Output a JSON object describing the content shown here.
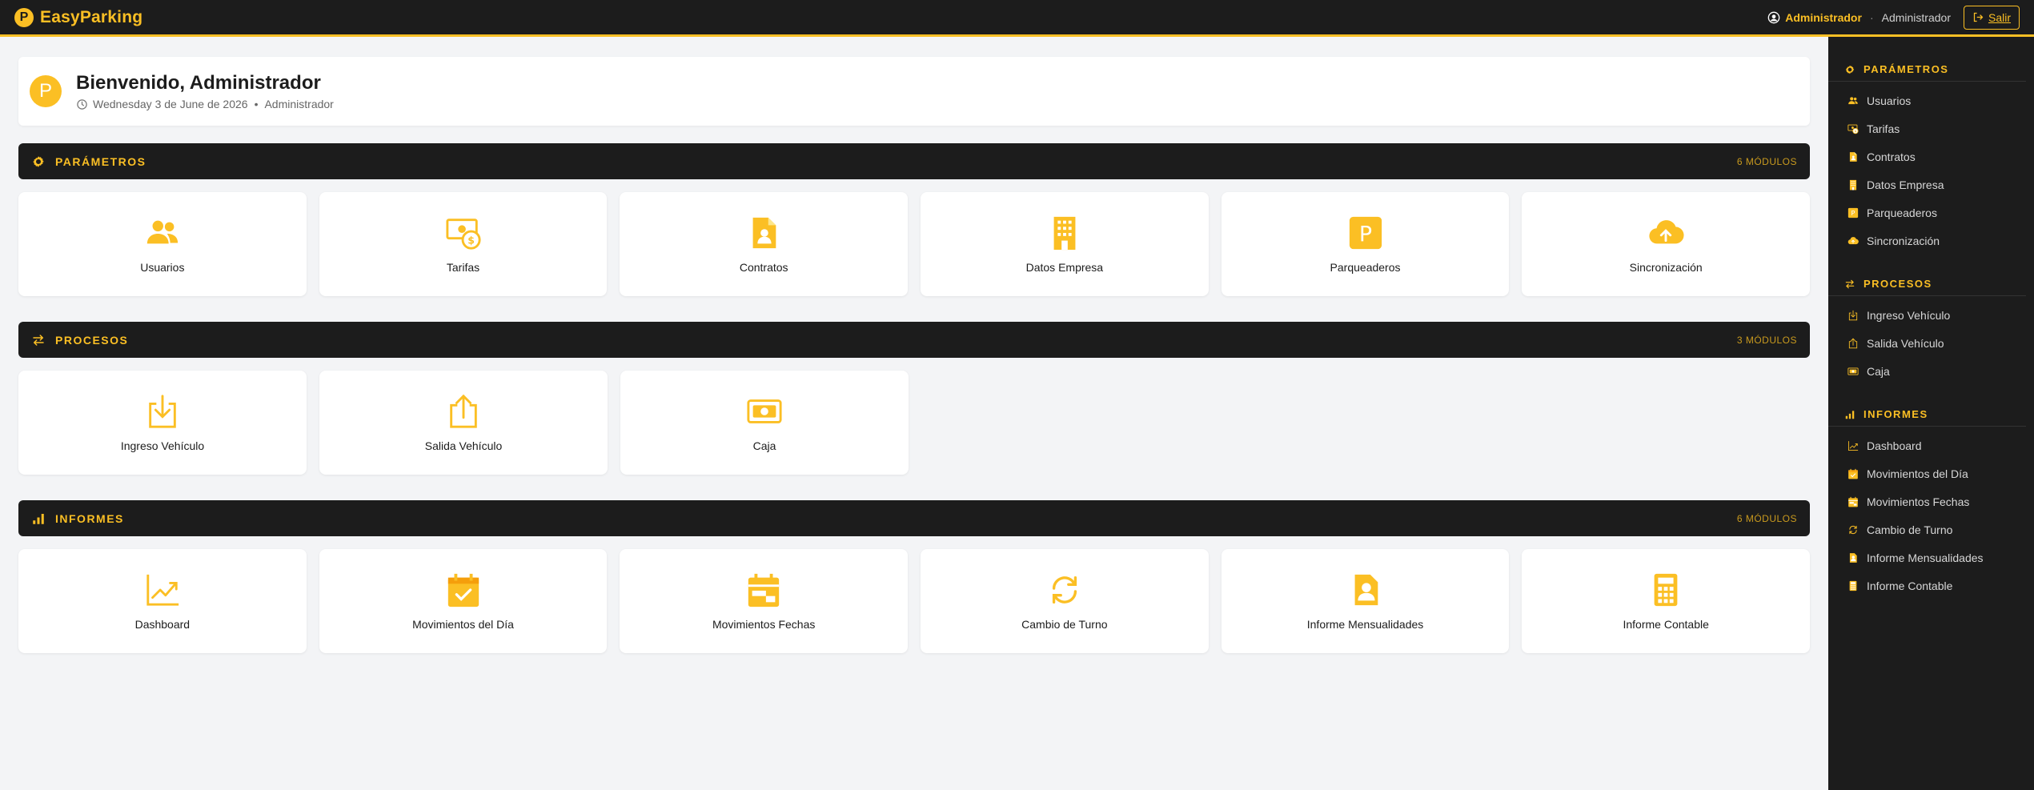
{
  "brand": {
    "logo_letter": "P",
    "name": "EasyParking"
  },
  "header": {
    "user_name": "Administrador",
    "separator": "·",
    "user_role": "Administrador",
    "logout_label": "Salir"
  },
  "welcome": {
    "logo_letter": "P",
    "title": "Bienvenido, Administrador",
    "date": "Wednesday 3 de June de 2026",
    "bullet": "•",
    "role": "Administrador"
  },
  "colors": {
    "accent": "#fbbf24",
    "dark": "#1c1c1c",
    "background": "#f3f4f6"
  },
  "sections": {
    "parametros": {
      "title": "PARÁMETROS",
      "count": "6 MÓDULOS",
      "icon": "gear-icon",
      "cards": [
        {
          "label": "Usuarios",
          "icon": "users-icon"
        },
        {
          "label": "Tarifas",
          "icon": "money-icon"
        },
        {
          "label": "Contratos",
          "icon": "contract-icon"
        },
        {
          "label": "Datos Empresa",
          "icon": "building-icon"
        },
        {
          "label": "Parqueaderos",
          "icon": "parking-icon"
        },
        {
          "label": "Sincronización",
          "icon": "cloud-upload-icon"
        }
      ]
    },
    "procesos": {
      "title": "PROCESOS",
      "count": "3 MÓDULOS",
      "icon": "exchange-icon",
      "cards": [
        {
          "label": "Ingreso Vehículo",
          "icon": "download-icon"
        },
        {
          "label": "Salida Vehículo",
          "icon": "upload-icon"
        },
        {
          "label": "Caja",
          "icon": "cash-icon"
        }
      ]
    },
    "informes": {
      "title": "INFORMES",
      "count": "6 MÓDULOS",
      "icon": "bar-chart-icon",
      "cards": [
        {
          "label": "Dashboard",
          "icon": "trend-icon"
        },
        {
          "label": "Movimientos del Día",
          "icon": "calendar-check-icon"
        },
        {
          "label": "Movimientos Fechas",
          "icon": "calendar-range-icon"
        },
        {
          "label": "Cambio de Turno",
          "icon": "sync-icon"
        },
        {
          "label": "Informe Mensualidades",
          "icon": "person-doc-icon"
        },
        {
          "label": "Informe Contable",
          "icon": "calculator-icon"
        }
      ]
    }
  },
  "sidebar": {
    "parametros": {
      "title": "PARÁMETROS",
      "items": [
        {
          "label": "Usuarios"
        },
        {
          "label": "Tarifas"
        },
        {
          "label": "Contratos"
        },
        {
          "label": "Datos Empresa"
        },
        {
          "label": "Parqueaderos"
        },
        {
          "label": "Sincronización"
        }
      ]
    },
    "procesos": {
      "title": "PROCESOS",
      "items": [
        {
          "label": "Ingreso Vehículo"
        },
        {
          "label": "Salida Vehículo"
        },
        {
          "label": "Caja"
        }
      ]
    },
    "informes": {
      "title": "INFORMES",
      "items": [
        {
          "label": "Dashboard"
        },
        {
          "label": "Movimientos del Día"
        },
        {
          "label": "Movimientos Fechas"
        },
        {
          "label": "Cambio de Turno"
        },
        {
          "label": "Informe Mensualidades"
        },
        {
          "label": "Informe Contable"
        }
      ]
    }
  }
}
